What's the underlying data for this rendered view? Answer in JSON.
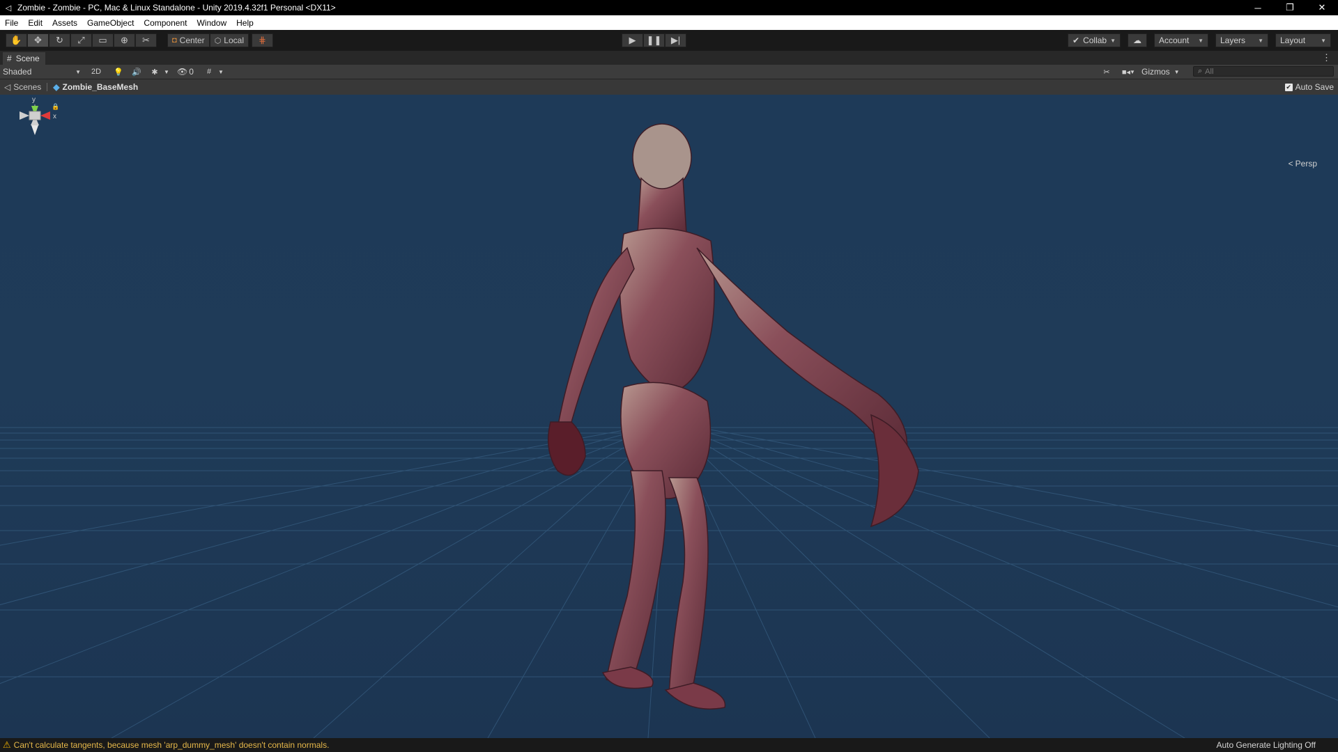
{
  "window": {
    "title": "Zombie - Zombie - PC, Mac & Linux Standalone - Unity 2019.4.32f1 Personal <DX11>",
    "controls": [
      "─",
      "❐",
      "✕"
    ]
  },
  "menu": [
    "File",
    "Edit",
    "Assets",
    "GameObject",
    "Component",
    "Window",
    "Help"
  ],
  "toolbar": {
    "pivot_label": "Center",
    "rotation_label": "Local",
    "collab_label": "Collab",
    "account_label": "Account",
    "layers_label": "Layers",
    "layout_label": "Layout"
  },
  "scene_tab": {
    "label": "Scene"
  },
  "scene_toolbar": {
    "draw_mode": "Shaded",
    "mode_2d": "2D",
    "hidden_count": "0",
    "gizmos_label": "Gizmos",
    "search_placeholder": "All"
  },
  "breadcrumb": {
    "root": "Scenes",
    "current": "Zombie_BaseMesh",
    "auto_save_label": "Auto Save",
    "auto_save_checked": true
  },
  "viewport": {
    "background_color": "#1f3b58",
    "projection_label": "Persp",
    "gizmo_axes": {
      "y": "y",
      "x": "x"
    }
  },
  "status": {
    "warning": "Can't calculate tangents, because mesh 'arp_dummy_mesh' doesn't contain normals.",
    "lighting": "Auto Generate Lighting Off"
  }
}
